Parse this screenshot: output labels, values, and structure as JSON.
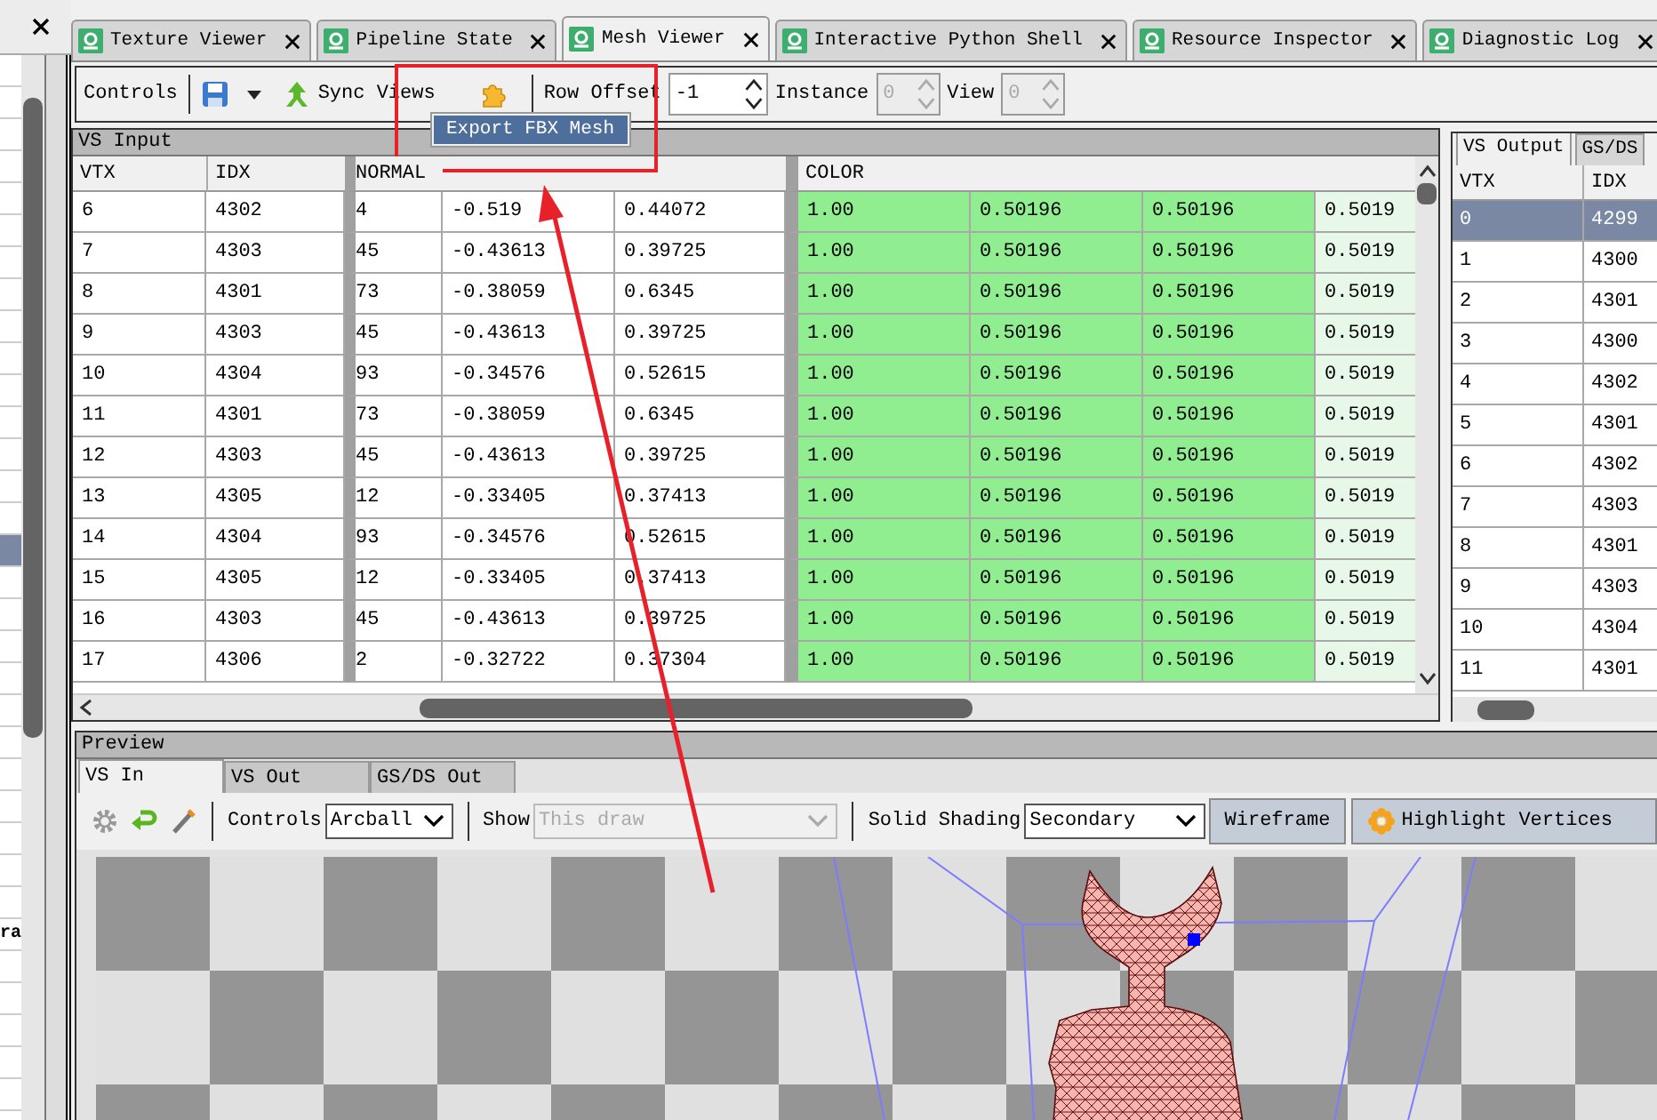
{
  "left_panel": {
    "items": [
      {
        "selected": false
      },
      {
        "selected": false
      },
      {
        "selected": false
      },
      {
        "selected": false
      },
      {
        "selected": false
      },
      {
        "selected": false
      },
      {
        "selected": false
      },
      {
        "selected": false
      },
      {
        "selected": false
      },
      {
        "selected": false
      },
      {
        "selected": false
      },
      {
        "selected": false
      },
      {
        "selected": false
      },
      {
        "selected": false
      },
      {
        "selected": false
      },
      {
        "selected": true
      },
      {
        "selected": false
      },
      {
        "selected": false
      },
      {
        "selected": false
      },
      {
        "selected": false
      },
      {
        "selected": false
      },
      {
        "selected": false
      },
      {
        "selected": false
      },
      {
        "selected": false
      },
      {
        "selected": false
      },
      {
        "selected": false
      },
      {
        "selected": false
      },
      {
        "selected": false,
        "label": "ra"
      },
      {
        "selected": false
      },
      {
        "selected": false
      },
      {
        "selected": false
      },
      {
        "selected": false
      },
      {
        "selected": false
      }
    ]
  },
  "tabs": [
    {
      "label": "Texture Viewer",
      "selected": false
    },
    {
      "label": "Pipeline State",
      "selected": false
    },
    {
      "label": "Mesh Viewer",
      "selected": true
    },
    {
      "label": "Interactive Python Shell",
      "selected": false
    },
    {
      "label": "Resource Inspector",
      "selected": false
    },
    {
      "label": "Diagnostic Log",
      "selected": false
    }
  ],
  "toolbar": {
    "controls_label": "Controls",
    "sync_views": "Sync Views",
    "row_offset": {
      "label": "Row Offset",
      "value": "-1",
      "disabled": false
    },
    "instance": {
      "label": "Instance",
      "value": "0",
      "disabled": true
    },
    "view": {
      "label": "View",
      "value": "0",
      "disabled": true
    },
    "popup_menu": {
      "items": [
        "Export FBX Mesh"
      ]
    }
  },
  "vs_input": {
    "title": "VS Input",
    "columns": [
      "VTX",
      "IDX",
      "NORMAL",
      "",
      "",
      "COLOR",
      "",
      "",
      ""
    ],
    "rows": [
      [
        "6",
        "4302",
        "4",
        "-0.519",
        "0.44072",
        "1.00",
        "0.50196",
        "0.50196",
        "0.5019"
      ],
      [
        "7",
        "4303",
        "45",
        "-0.43613",
        "0.39725",
        "1.00",
        "0.50196",
        "0.50196",
        "0.5019"
      ],
      [
        "8",
        "4301",
        "73",
        "-0.38059",
        "0.6345",
        "1.00",
        "0.50196",
        "0.50196",
        "0.5019"
      ],
      [
        "9",
        "4303",
        "45",
        "-0.43613",
        "0.39725",
        "1.00",
        "0.50196",
        "0.50196",
        "0.5019"
      ],
      [
        "10",
        "4304",
        "93",
        "-0.34576",
        "0.52615",
        "1.00",
        "0.50196",
        "0.50196",
        "0.5019"
      ],
      [
        "11",
        "4301",
        "73",
        "-0.38059",
        "0.6345",
        "1.00",
        "0.50196",
        "0.50196",
        "0.5019"
      ],
      [
        "12",
        "4303",
        "45",
        "-0.43613",
        "0.39725",
        "1.00",
        "0.50196",
        "0.50196",
        "0.5019"
      ],
      [
        "13",
        "4305",
        "12",
        "-0.33405",
        "0.37413",
        "1.00",
        "0.50196",
        "0.50196",
        "0.5019"
      ],
      [
        "14",
        "4304",
        "93",
        "-0.34576",
        "0.52615",
        "1.00",
        "0.50196",
        "0.50196",
        "0.5019"
      ],
      [
        "15",
        "4305",
        "12",
        "-0.33405",
        "0.37413",
        "1.00",
        "0.50196",
        "0.50196",
        "0.5019"
      ],
      [
        "16",
        "4303",
        "45",
        "-0.43613",
        "0.39725",
        "1.00",
        "0.50196",
        "0.50196",
        "0.5019"
      ],
      [
        "17",
        "4306",
        "2",
        "-0.32722",
        "0.37304",
        "1.00",
        "0.50196",
        "0.50196",
        "0.5019"
      ]
    ]
  },
  "vs_output": {
    "tabs": [
      {
        "label": "VS Output",
        "selected": true
      },
      {
        "label": "GS/DS",
        "selected": false
      }
    ],
    "columns": [
      "VTX",
      "IDX"
    ],
    "rows": [
      {
        "cells": [
          "0",
          "4299"
        ],
        "selected": true
      },
      {
        "cells": [
          "1",
          "4300"
        ],
        "selected": false
      },
      {
        "cells": [
          "2",
          "4301"
        ],
        "selected": false
      },
      {
        "cells": [
          "3",
          "4300"
        ],
        "selected": false
      },
      {
        "cells": [
          "4",
          "4302"
        ],
        "selected": false
      },
      {
        "cells": [
          "5",
          "4301"
        ],
        "selected": false
      },
      {
        "cells": [
          "6",
          "4302"
        ],
        "selected": false
      },
      {
        "cells": [
          "7",
          "4303"
        ],
        "selected": false
      },
      {
        "cells": [
          "8",
          "4301"
        ],
        "selected": false
      },
      {
        "cells": [
          "9",
          "4303"
        ],
        "selected": false
      },
      {
        "cells": [
          "10",
          "4304"
        ],
        "selected": false
      },
      {
        "cells": [
          "11",
          "4301"
        ],
        "selected": false
      }
    ]
  },
  "preview": {
    "title": "Preview",
    "tabs": [
      {
        "label": "VS In",
        "selected": true
      },
      {
        "label": "VS Out",
        "selected": false
      },
      {
        "label": "GS/DS Out",
        "selected": false
      }
    ],
    "controls": {
      "label": "Controls",
      "value": "Arcball",
      "disabled": false
    },
    "show": {
      "label": "Show",
      "value": "This draw",
      "disabled": true
    },
    "solid_shading": {
      "label": "Solid Shading",
      "value": "Secondary",
      "disabled": false
    },
    "buttons": [
      {
        "label": "Wireframe",
        "kind": "plain",
        "checked": true
      },
      {
        "label": "Highlight Vertices",
        "kind": "icon",
        "checked": true
      }
    ]
  }
}
